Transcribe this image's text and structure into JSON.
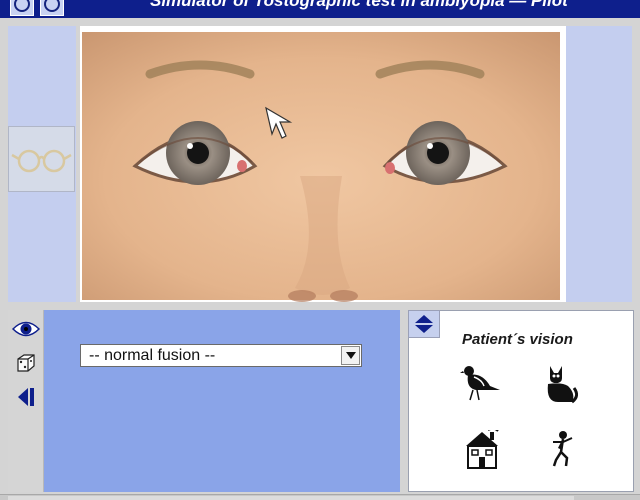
{
  "window": {
    "title": "Simulator of Test in amblyopia — Pilot",
    "title_visible": "Simulator of Tostographic test in amblyopia — Pilot"
  },
  "titlebar": {
    "buttons": [
      {
        "icon": "info-icon"
      },
      {
        "icon": "info-icon"
      }
    ]
  },
  "viewer": {
    "left_button_icon": "glasses-icon",
    "image": "face-eyes-closeup"
  },
  "sidebar": {
    "buttons": [
      {
        "icon": "eye-icon"
      },
      {
        "icon": "dice-icon"
      },
      {
        "icon": "step-back-icon"
      }
    ]
  },
  "controls": {
    "fusion_select": {
      "value": "-- normal fusion --"
    }
  },
  "vision_panel": {
    "title": "Patient´s vision",
    "toggle_icon": "expand-collapse-icon",
    "symbols": [
      "bird-icon",
      "cat-icon",
      "house-icon",
      "running-man-icon"
    ]
  },
  "colors": {
    "titlebar": "#0e1f8c",
    "panel_blue": "#8aa4e8",
    "side_blue": "#c4ceef",
    "skin": "#e7bd97",
    "iris": "#8a7e72",
    "brow": "#9e8058"
  }
}
